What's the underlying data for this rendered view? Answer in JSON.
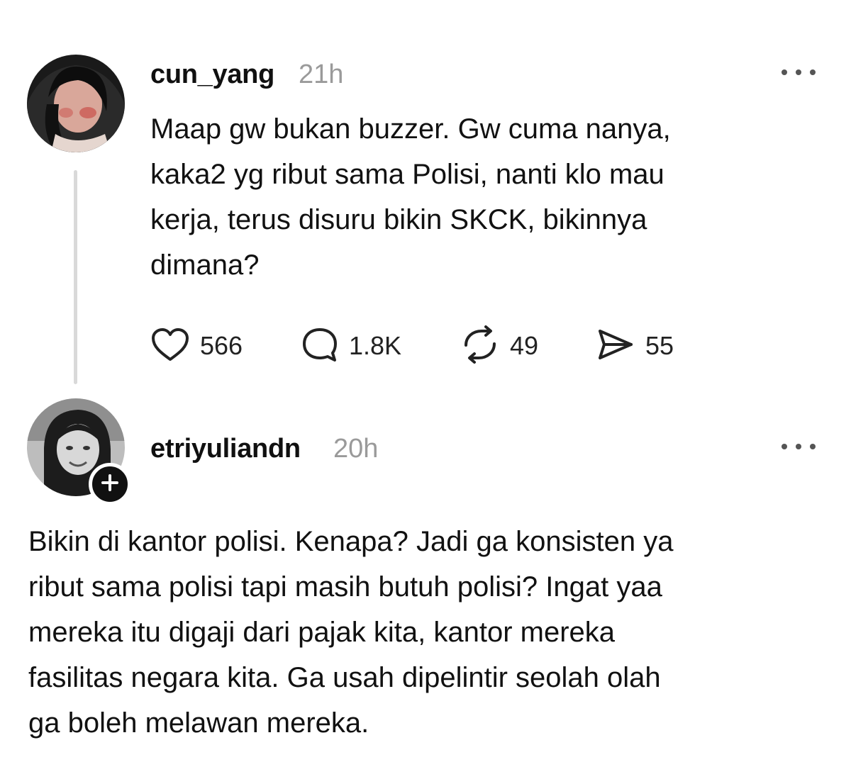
{
  "post": {
    "username": "cun_yang",
    "time": "21h",
    "text": "Maap gw bukan buzzer. Gw cuma nanya,\nkaka2 yg ribut sama Polisi, nanti klo mau\nkerja, terus disuru bikin SKCK, bikinnya\ndimana?",
    "actions": {
      "likes": "566",
      "replies": "1.8K",
      "reposts": "49",
      "shares": "55"
    },
    "icons": [
      "heart-icon",
      "comment-icon",
      "repost-icon",
      "share-icon",
      "more-icon"
    ]
  },
  "reply": {
    "username": "etriyuliandn",
    "time": "20h",
    "text": "Bikin di kantor polisi. Kenapa? Jadi ga konsisten ya\nribut sama polisi tapi masih butuh polisi? Ingat yaa\nmereka itu digaji dari pajak kita, kantor mereka\nfasilitas negara kita. Ga usah dipelintir seolah olah\nga boleh melawan mereka."
  },
  "colors": {
    "text": "#101010",
    "muted": "#9a9a9a",
    "thread_line": "#d9d9d9",
    "badge": "#111111"
  }
}
